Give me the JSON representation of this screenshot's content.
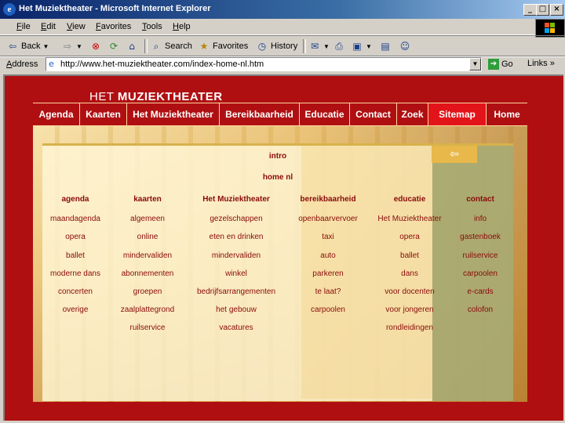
{
  "window": {
    "title": "Het Muziektheater - Microsoft Internet Explorer"
  },
  "menu": [
    "File",
    "Edit",
    "View",
    "Favorites",
    "Tools",
    "Help"
  ],
  "toolbar": {
    "back": "Back",
    "search": "Search",
    "favorites": "Favorites",
    "history": "History"
  },
  "address": {
    "label": "Address",
    "url": "http://www.het-muziektheater.com/index-home-nl.htm",
    "go": "Go",
    "links": "Links"
  },
  "site": {
    "logo_light": "HET",
    "logo_bold": "MUZIEKTHEATER",
    "nav": [
      "Agenda",
      "Kaarten",
      "Het Muziektheater",
      "Bereikbaarheid",
      "Educatie",
      "Contact",
      "Zoek",
      "Sitemap",
      "Home"
    ],
    "nav_active": "Sitemap",
    "intro": "intro",
    "home": "home nl",
    "columns": [
      {
        "head": "agenda",
        "items": [
          "maandagenda",
          "opera",
          "ballet",
          "moderne dans",
          "concerten",
          "overige"
        ]
      },
      {
        "head": "kaarten",
        "items": [
          "algemeen",
          "online",
          "mindervaliden",
          "abonnementen",
          "groepen",
          "zaalplattegrond",
          "ruilservice"
        ]
      },
      {
        "head": "Het Muziektheater",
        "items": [
          "gezelschappen",
          "eten en drinken",
          "mindervaliden",
          "winkel",
          "bedrijfsarrangementen",
          "het gebouw",
          "vacatures"
        ]
      },
      {
        "head": "bereikbaarheid",
        "items": [
          "openbaarvervoer",
          "taxi",
          "auto",
          "parkeren",
          "te laat?",
          "carpoolen"
        ]
      },
      {
        "head": "educatie",
        "items": [
          "Het Muziektheater",
          "opera",
          "ballet",
          "dans",
          "voor docenten",
          "voor jongeren",
          "rondleidingen"
        ]
      },
      {
        "head": "contact",
        "items": [
          "info",
          "gastenboek",
          "ruilservice",
          "carpoolen",
          "e-cards",
          "colofon"
        ]
      }
    ]
  }
}
